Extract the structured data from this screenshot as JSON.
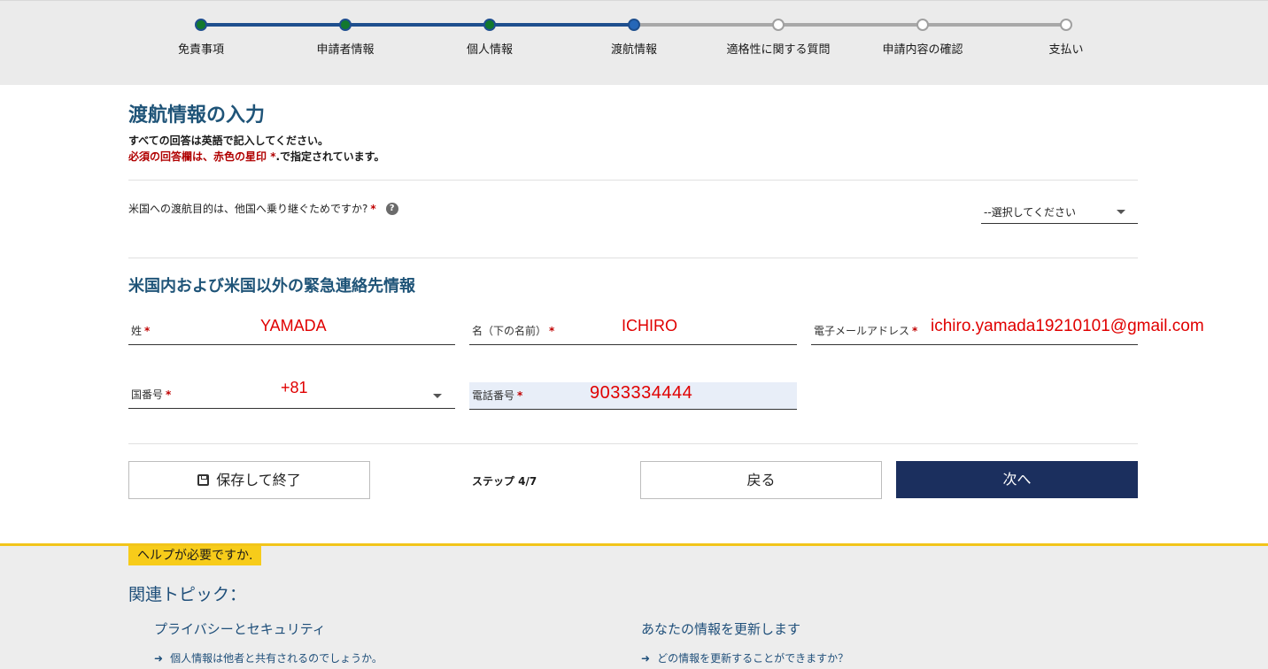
{
  "steps": [
    {
      "label": "免責事項",
      "state": "done"
    },
    {
      "label": "申請者情報",
      "state": "done"
    },
    {
      "label": "個人情報",
      "state": "done"
    },
    {
      "label": "渡航情報",
      "state": "current"
    },
    {
      "label": "適格性に関する質問",
      "state": "todo"
    },
    {
      "label": "申請内容の確認",
      "state": "todo"
    },
    {
      "label": "支払い",
      "state": "todo"
    }
  ],
  "page": {
    "title": "渡航情報の入力",
    "instruction": "すべての回答は英語で記入してください。",
    "required_note_red": "必須の回答欄は、赤色の星印",
    "required_note_star": "*",
    "required_note_rest": ".で指定されています。"
  },
  "transit": {
    "question": "米国への渡航目的は、他国へ乗り継ぐためですか?",
    "star": "*",
    "help_glyph": "?",
    "select_value": "--選択してください"
  },
  "emergency": {
    "title": "米国内および米国以外の緊急連絡先情報",
    "last_name_label": "姓",
    "last_name_value": "YAMADA",
    "first_name_label": "名（下の名前）",
    "first_name_value": "ICHIRO",
    "email_label": "電子メールアドレス",
    "email_value": "ichiro.yamada19210101@gmail.com",
    "country_code_label": "国番号",
    "country_code_value": "+81",
    "phone_label": "電話番号",
    "phone_value": "9033334444",
    "star": "*"
  },
  "actions": {
    "save_label": "保存して終了",
    "step_text": "ステップ 4/7",
    "back_label": "戻る",
    "next_label": "次へ"
  },
  "help": {
    "tag": "ヘルプが必要ですか.",
    "related_title": "関連トピック：",
    "topics": [
      {
        "title": "プライバシーとセキュリティ",
        "link": "個人情報は他者と共有されるのでしょうか。"
      },
      {
        "title": "あなたの情報を更新します",
        "link": "どの情報を更新することができますか？"
      }
    ],
    "arrow_glyph": "➜"
  },
  "colors": {
    "accent_blue": "#1f5478",
    "navy_button": "#1b2f5e",
    "required_red": "#c00000",
    "filled_value_red": "#e00000",
    "help_yellow": "#f7cc1a",
    "step_done_green": "#12782e"
  }
}
